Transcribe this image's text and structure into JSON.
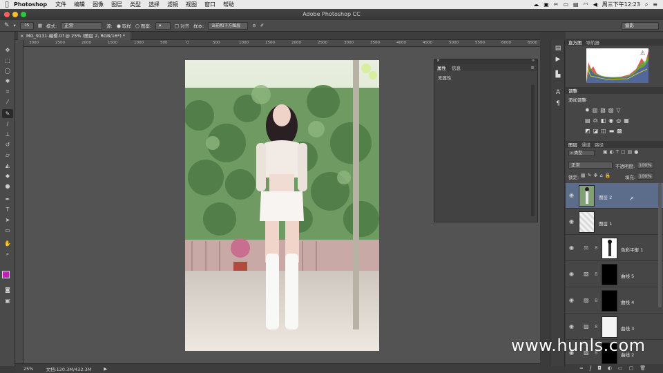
{
  "menubar": {
    "apple": "",
    "app": "Photoshop",
    "items": [
      "文件",
      "编辑",
      "图像",
      "图层",
      "类型",
      "选择",
      "滤镜",
      "视图",
      "窗口",
      "帮助"
    ],
    "clock": "周三下午12:23"
  },
  "window": {
    "title": "Adobe Photoshop CC"
  },
  "options": {
    "brush_size": "15",
    "mode_label": "模式:",
    "mode_value": "正常",
    "source_label": "源:",
    "sampled_label": "取样",
    "pattern_label": "图案:",
    "aligned_label": "对齐",
    "sample_label": "样本:",
    "sample_value": "当前和下方图层",
    "workspace": "摄影"
  },
  "document": {
    "tab": "MG_9131-编辑.tif @ 25% (图层 2, RGB/16*) *",
    "ruler_labels": [
      "3000",
      "2500",
      "2000",
      "1500",
      "1000",
      "500",
      "0",
      "500",
      "1000",
      "1500",
      "2000",
      "2500",
      "3000",
      "3500",
      "4000",
      "4500",
      "5000",
      "5500",
      "6000",
      "6500"
    ]
  },
  "status": {
    "zoom": "25%",
    "doc": "文档:120.3M/432.3M"
  },
  "properties": {
    "tab1": "属性",
    "tab2": "信息",
    "no_attr": "无属性"
  },
  "histogram": {
    "tab1": "直方图",
    "tab2": "导航器"
  },
  "adjustments": {
    "tab": "调整",
    "title": "添加调整"
  },
  "layers_panel": {
    "tab1": "图层",
    "tab2": "通道",
    "tab3": "路径",
    "filter": "类型",
    "blend": "正常",
    "opacity_label": "不透明度:",
    "opacity": "100%",
    "lock_label": "锁定:",
    "fill_label": "填充:",
    "fill": "100%",
    "layers": [
      {
        "name": "图层 2",
        "selected": true
      },
      {
        "name": "图层 1",
        "selected": false
      },
      {
        "name": "色彩平衡 1",
        "selected": false
      },
      {
        "name": "曲线 5",
        "selected": false
      },
      {
        "name": "曲线 4",
        "selected": false
      },
      {
        "name": "曲线 3",
        "selected": false
      },
      {
        "name": "曲线 2",
        "selected": false
      }
    ]
  },
  "colors": {
    "foreground": "#c21fb5",
    "background": "#111111",
    "selected_layer": "#5c6d8c"
  },
  "watermark": "www.hunls.com"
}
